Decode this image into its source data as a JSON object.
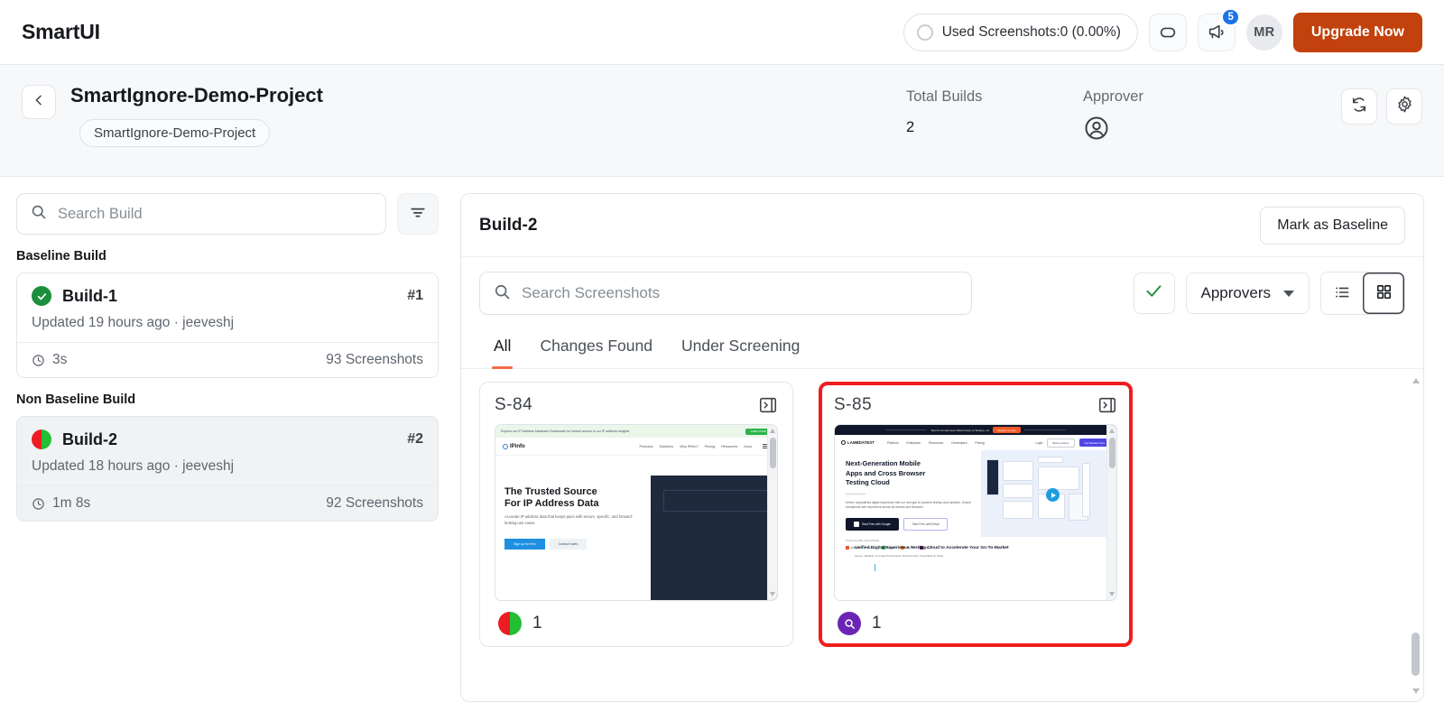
{
  "app": {
    "brand": "SmartUI"
  },
  "topbar": {
    "usage_label": "Used Screenshots:0 (0.00%)",
    "link_icon": "link-icon",
    "announce_icon": "megaphone-icon",
    "announce_badge": "5",
    "avatar_initials": "MR",
    "upgrade_label": "Upgrade Now"
  },
  "project": {
    "back_icon": "chevron-left-icon",
    "name": "SmartIgnore-Demo-Project",
    "chip": "SmartIgnore-Demo-Project",
    "total_builds_label": "Total Builds",
    "total_builds_value": "2",
    "approver_label": "Approver",
    "approver_icon": "user-circle-icon",
    "refresh_icon": "refresh-icon",
    "settings_icon": "gear-icon"
  },
  "sidebar": {
    "search_placeholder": "Search Build",
    "search_value": "",
    "search_icon": "search-icon",
    "filter_icon": "filter-icon",
    "groups": [
      {
        "label": "Baseline Build",
        "builds": [
          {
            "name": "Build-1",
            "number": "#1",
            "status": "pass",
            "meta": "Updated 19 hours ago · jeeveshj",
            "duration": "3s",
            "screenshots": "93 Screenshots",
            "selected": false
          }
        ]
      },
      {
        "label": "Non Baseline Build",
        "builds": [
          {
            "name": "Build-2",
            "number": "#2",
            "status": "mixed",
            "meta": "Updated 18 hours ago · jeeveshj",
            "duration": "1m 8s",
            "screenshots": "92 Screenshots",
            "selected": true
          }
        ]
      }
    ]
  },
  "main": {
    "build_title": "Build-2",
    "mark_baseline_label": "Mark as Baseline",
    "search_placeholder": "Search Screenshots",
    "search_value": "",
    "approve_icon": "check-icon",
    "approvers_label": "Approvers",
    "list_view_icon": "list-view-icon",
    "grid_view_icon": "grid-view-icon",
    "active_view": "grid",
    "tabs": [
      {
        "label": "All",
        "active": true
      },
      {
        "label": "Changes Found",
        "active": false
      },
      {
        "label": "Under Screening",
        "active": false
      }
    ],
    "cards": [
      {
        "id": "S-84",
        "expand_icon": "panel-expand-icon",
        "badge_type": "mixed",
        "count": "1",
        "selected": false,
        "thumbnail": "ipinfo"
      },
      {
        "id": "S-85",
        "expand_icon": "panel-expand-icon",
        "badge_type": "screening",
        "badge_icon": "magnifier-icon",
        "count": "1",
        "selected": true,
        "thumbnail": "lambdatest"
      }
    ]
  },
  "thumbnails": {
    "ipinfo": {
      "banner_text": "Explore our IP Address Database Downloads for instant access to our IP address insights",
      "banner_cta": "Learn more",
      "logo": "IPinfo",
      "nav": [
        "Products",
        "Solutions",
        "Why IPinfo?",
        "Pricing",
        "Resources",
        "Docs"
      ],
      "headline_line1": "The Trusted Source",
      "headline_line2": "For IP Address Data",
      "paragraph": "Accurate IP address data that keeps pace with secure, specific, and forward-looking use cases.",
      "btn_primary": "Sign up for free",
      "btn_secondary": "Contact sales"
    },
    "lambdatest": {
      "top_banner": "Test No Conference's Bold Future of Testing + AI",
      "top_cta": "Register for Free",
      "logo": "LAMBDATEST",
      "nav": [
        "Platform",
        "Enterprise",
        "Resources",
        "Developers",
        "Pricing"
      ],
      "login": "Login",
      "demo_btn": "Book a Demo",
      "free_btn": "Get Started Free",
      "headline_line1": "Next-Generation Mobile",
      "headline_line2": "Apps and Cross Browser",
      "headline_line3": "Testing Cloud",
      "paragraph": "Deliver unparalleled digital experience with our next-gen AI powered testing cloud platform. Ensure exceptional user experience across all devices and browsers.",
      "btn_google": "Start Free with Google",
      "btn_email": "Start Free with Email",
      "trust_text": "Trusted by 2M+ users globally",
      "brand_logos": [
        "Microsoft",
        "vimeo",
        "Telstra",
        "xiaomi",
        "slack"
      ],
      "footer_title": "Unified Digital Experience Testing Cloud to Accelerate Your Go-To-Market",
      "footer_sub": "Secure, Reliable, and High Performance Test Execution Cloud Built for Scale"
    }
  },
  "colors": {
    "accent": "#f26b43",
    "upgrade": "#c2410c",
    "selection": "#f21c1c",
    "pass": "#1a8f3c",
    "fail": "#ec1c24",
    "screening": "#6a25b5",
    "badge_blue": "#1a73e8"
  }
}
